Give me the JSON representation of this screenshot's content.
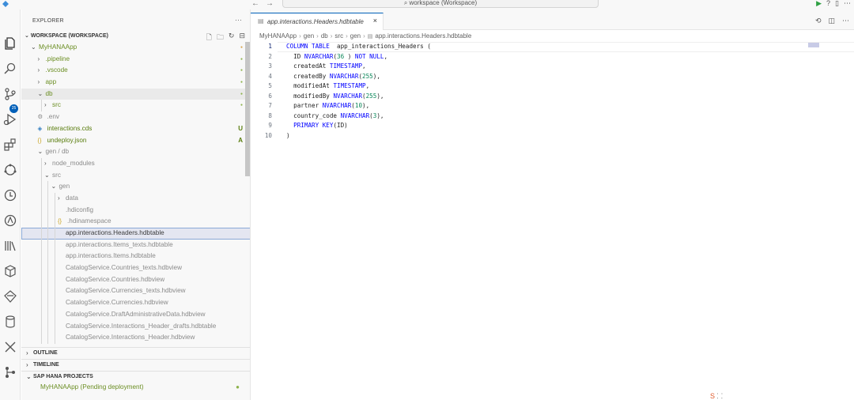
{
  "titlebar": {
    "command_center": "workspace (Workspace)",
    "nav_back": "←",
    "nav_forward": "→"
  },
  "activity": {
    "scm_badge": "25"
  },
  "sidebar": {
    "header": "EXPLORER",
    "more": "···",
    "workspace_label": "WORKSPACE (WORKSPACE)",
    "tree": [
      {
        "label": "MyHANAApp",
        "twisty": "⌄",
        "indent": 0,
        "cls": "greenish",
        "deco": "●",
        "deco_cls": "dot-orange"
      },
      {
        "label": ".pipeline",
        "twisty": "›",
        "indent": 1,
        "cls": "greenish",
        "deco": "●",
        "deco_cls": "dot-green"
      },
      {
        "label": ".vscode",
        "twisty": "›",
        "indent": 1,
        "cls": "greenish",
        "deco": "●",
        "deco_cls": "dot-green"
      },
      {
        "label": "app",
        "twisty": "›",
        "indent": 1,
        "cls": "greenish",
        "deco": "●",
        "deco_cls": "dot-green"
      },
      {
        "label": "db",
        "twisty": "⌄",
        "indent": 1,
        "cls": "greenish",
        "deco": "●",
        "deco_cls": "dot-green",
        "hover": true
      },
      {
        "label": "src",
        "twisty": "›",
        "indent": 2,
        "cls": "greenish",
        "deco": "●",
        "deco_cls": "dot-green"
      },
      {
        "label": ".env",
        "icon": "⚙",
        "indent": 1,
        "cls": "gray"
      },
      {
        "label": "interactions.cds",
        "icon": "◈",
        "icon_cls": "icon-blue",
        "indent": 1,
        "cls": "green",
        "deco": "U",
        "deco_cls": "green"
      },
      {
        "label": "undeploy.json",
        "icon": "{}",
        "icon_cls": "icon-yellow",
        "indent": 1,
        "cls": "green",
        "deco": "A",
        "deco_cls": "green"
      },
      {
        "label": "gen / db",
        "twisty": "⌄",
        "indent": 1,
        "cls": "gray"
      },
      {
        "label": "node_modules",
        "twisty": "›",
        "indent": 2,
        "cls": "gray"
      },
      {
        "label": "src",
        "twisty": "⌄",
        "indent": 2,
        "cls": "gray"
      },
      {
        "label": "gen",
        "twisty": "⌄",
        "indent": 3,
        "cls": "gray"
      },
      {
        "label": "data",
        "twisty": "›",
        "indent": 4,
        "cls": "gray"
      },
      {
        "label": ".hdiconfig",
        "icon": "",
        "indent": 4,
        "cls": "gray"
      },
      {
        "label": ".hdinamespace",
        "icon": "{}",
        "icon_cls": "icon-yellow",
        "indent": 4,
        "cls": "gray"
      },
      {
        "label": "app.interactions.Headers.hdbtable",
        "icon": "",
        "indent": 4,
        "cls": "",
        "selected": true
      },
      {
        "label": "app.interactions.Items_texts.hdbtable",
        "icon": "",
        "indent": 4,
        "cls": "gray"
      },
      {
        "label": "app.interactions.Items.hdbtable",
        "icon": "",
        "indent": 4,
        "cls": "gray"
      },
      {
        "label": "CatalogService.Countries_texts.hdbview",
        "icon": "",
        "indent": 4,
        "cls": "gray"
      },
      {
        "label": "CatalogService.Countries.hdbview",
        "icon": "",
        "indent": 4,
        "cls": "gray"
      },
      {
        "label": "CatalogService.Currencies_texts.hdbview",
        "icon": "",
        "indent": 4,
        "cls": "gray"
      },
      {
        "label": "CatalogService.Currencies.hdbview",
        "icon": "",
        "indent": 4,
        "cls": "gray"
      },
      {
        "label": "CatalogService.DraftAdministrativeData.hdbview",
        "icon": "",
        "indent": 4,
        "cls": "gray"
      },
      {
        "label": "CatalogService.Interactions_Header_drafts.hdbtable",
        "icon": "",
        "indent": 4,
        "cls": "gray"
      },
      {
        "label": "CatalogService.Interactions_Header.hdbview",
        "icon": "",
        "indent": 4,
        "cls": "gray"
      }
    ],
    "outline_label": "OUTLINE",
    "timeline_label": "TIMELINE",
    "sap_label": "SAP HANA PROJECTS",
    "sap_item": "MyHANAApp (Pending deployment)"
  },
  "editor": {
    "tab_label": "app.interactions.Headers.hdbtable",
    "tab_close": "×",
    "breadcrumb": [
      "MyHANAApp",
      "gen",
      "db",
      "src",
      "gen",
      "app.interactions.Headers.hdbtable"
    ],
    "lines": [
      {
        "n": "1",
        "tokens": [
          [
            "kw",
            "COLUMN TABLE"
          ],
          [
            "",
            "  app_interactions_Headers "
          ],
          [
            "",
            "("
          ]
        ]
      },
      {
        "n": "2",
        "tokens": [
          [
            "",
            "  ID "
          ],
          [
            "ty",
            "NVARCHAR"
          ],
          [
            "",
            "("
          ],
          [
            "num",
            "36"
          ],
          [
            "",
            " ) "
          ],
          [
            "kw",
            "NOT NULL"
          ],
          [
            "",
            ","
          ]
        ]
      },
      {
        "n": "3",
        "tokens": [
          [
            "",
            "  createdAt "
          ],
          [
            "ty",
            "TIMESTAMP"
          ],
          [
            "",
            ","
          ]
        ]
      },
      {
        "n": "4",
        "tokens": [
          [
            "",
            "  createdBy "
          ],
          [
            "ty",
            "NVARCHAR"
          ],
          [
            "",
            "("
          ],
          [
            "num",
            "255"
          ],
          [
            "",
            "),"
          ]
        ]
      },
      {
        "n": "5",
        "tokens": [
          [
            "",
            "  modifiedAt "
          ],
          [
            "ty",
            "TIMESTAMP"
          ],
          [
            "",
            ","
          ]
        ]
      },
      {
        "n": "6",
        "tokens": [
          [
            "",
            "  modifiedBy "
          ],
          [
            "ty",
            "NVARCHAR"
          ],
          [
            "",
            "("
          ],
          [
            "num",
            "255"
          ],
          [
            "",
            "),"
          ]
        ]
      },
      {
        "n": "7",
        "tokens": [
          [
            "",
            "  partner "
          ],
          [
            "ty",
            "NVARCHAR"
          ],
          [
            "",
            "("
          ],
          [
            "num",
            "10"
          ],
          [
            "",
            "),"
          ]
        ]
      },
      {
        "n": "8",
        "tokens": [
          [
            "",
            "  country_code "
          ],
          [
            "ty",
            "NVARCHAR"
          ],
          [
            "",
            "("
          ],
          [
            "num",
            "3"
          ],
          [
            "",
            "),"
          ]
        ]
      },
      {
        "n": "9",
        "tokens": [
          [
            "",
            "  "
          ],
          [
            "kw",
            "PRIMARY KEY"
          ],
          [
            "",
            "(ID)"
          ]
        ]
      },
      {
        "n": "10",
        "tokens": [
          [
            "",
            ")"
          ]
        ]
      }
    ]
  },
  "colors": {
    "accent": "#005fb8",
    "keyword": "#0000ff",
    "number": "#098658",
    "git_added": "#587c0c"
  }
}
